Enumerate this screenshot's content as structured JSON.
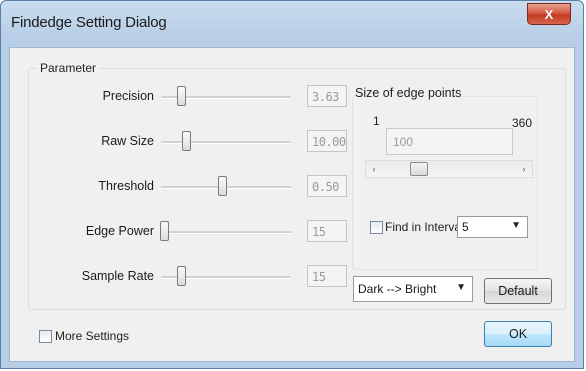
{
  "window": {
    "title": "Findedge Setting Dialog",
    "close_label": "X"
  },
  "parameter_group": {
    "title": "Parameter",
    "rows": [
      {
        "label": "Precision",
        "value": "3.63",
        "slider_fraction": 0.16
      },
      {
        "label": "Raw Size",
        "value": "10.00",
        "slider_fraction": 0.2
      },
      {
        "label": "Threshold",
        "value": "0.50",
        "slider_fraction": 0.48
      },
      {
        "label": "Edge Power",
        "value": "15",
        "slider_fraction": 0.03
      },
      {
        "label": "Sample Rate",
        "value": "15",
        "slider_fraction": 0.16
      }
    ]
  },
  "edge_points": {
    "title": "Size of edge points",
    "min_label": "1",
    "max_label": "360",
    "value": "100",
    "scroll_fraction": 0.24,
    "left_arrow": "‹",
    "right_arrow": "›"
  },
  "find_interval": {
    "label": "Find in Interva",
    "checked": false,
    "value": "5",
    "arrow": "▼"
  },
  "direction": {
    "value": "Dark --> Bright",
    "arrow": "▼"
  },
  "buttons": {
    "default_label": "Default",
    "ok_label": "OK"
  },
  "more_settings": {
    "label": "More Settings",
    "checked": false
  }
}
